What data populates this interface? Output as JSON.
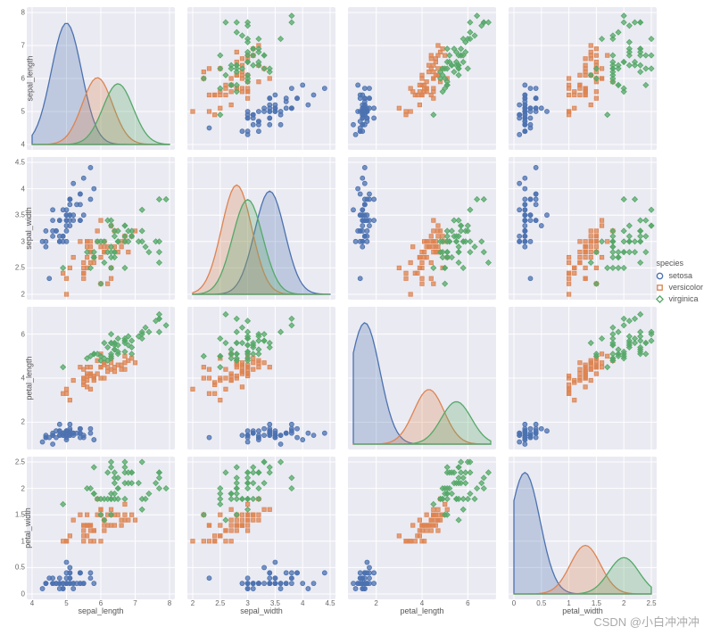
{
  "chart_data": {
    "type": "pairplot",
    "hue": "species",
    "variables": [
      "sepal_length",
      "sepal_width",
      "petal_length",
      "petal_width"
    ],
    "colors": {
      "setosa": "#4c72b0",
      "versicolor": "#dd8452",
      "virginica": "#55a868"
    },
    "markers": {
      "setosa": "circle",
      "versicolor": "square",
      "virginica": "diamond"
    },
    "ranges": {
      "sepal_length": [
        4,
        8
      ],
      "sepal_width": [
        2,
        4.5
      ],
      "petal_length": [
        1,
        7
      ],
      "petal_width": [
        0,
        2.5
      ]
    },
    "ticks": {
      "sepal_length": [
        4,
        5,
        6,
        7,
        8
      ],
      "sepal_width": [
        2.0,
        2.5,
        3.0,
        3.5,
        4.0,
        4.5
      ],
      "petal_length": [
        2,
        4,
        6
      ],
      "petal_width": [
        0.0,
        0.5,
        1.0,
        1.5,
        2.0,
        2.5
      ]
    },
    "kde_peaks": {
      "sepal_length": {
        "setosa": 5.0,
        "versicolor": 5.9,
        "virginica": 6.5
      },
      "sepal_width": {
        "setosa": 3.4,
        "versicolor": 2.8,
        "virginica": 3.0
      },
      "petal_length": {
        "setosa": 1.5,
        "versicolor": 4.3,
        "virginica": 5.5
      },
      "petal_width": {
        "setosa": 0.2,
        "versicolor": 1.3,
        "virginica": 2.0
      }
    },
    "legend": {
      "title": "species",
      "items": [
        "setosa",
        "versicolor",
        "virginica"
      ]
    },
    "data": {
      "setosa": {
        "sepal_length": [
          5.1,
          4.9,
          4.7,
          4.6,
          5.0,
          5.4,
          4.6,
          5.0,
          4.4,
          4.9,
          5.4,
          4.8,
          4.8,
          4.3,
          5.8,
          5.7,
          5.4,
          5.1,
          5.7,
          5.1,
          5.4,
          5.1,
          4.6,
          5.1,
          4.8,
          5.0,
          5.0,
          5.2,
          5.2,
          4.7,
          4.8,
          5.4,
          5.2,
          5.5,
          4.9,
          5.0,
          5.5,
          4.9,
          4.4,
          5.1,
          5.0,
          4.5,
          4.4,
          5.0,
          5.1,
          4.8,
          5.1,
          4.6,
          5.3,
          5.0
        ],
        "sepal_width": [
          3.5,
          3.0,
          3.2,
          3.1,
          3.6,
          3.9,
          3.4,
          3.4,
          2.9,
          3.1,
          3.7,
          3.4,
          3.0,
          3.0,
          4.0,
          4.4,
          3.9,
          3.5,
          3.8,
          3.8,
          3.4,
          3.7,
          3.6,
          3.3,
          3.4,
          3.0,
          3.4,
          3.5,
          3.4,
          3.2,
          3.1,
          3.4,
          4.1,
          4.2,
          3.1,
          3.2,
          3.5,
          3.6,
          3.0,
          3.4,
          3.5,
          2.3,
          3.2,
          3.5,
          3.8,
          3.0,
          3.8,
          3.2,
          3.7,
          3.3
        ],
        "petal_length": [
          1.4,
          1.4,
          1.3,
          1.5,
          1.4,
          1.7,
          1.4,
          1.5,
          1.4,
          1.5,
          1.5,
          1.6,
          1.4,
          1.1,
          1.2,
          1.5,
          1.3,
          1.4,
          1.7,
          1.5,
          1.7,
          1.5,
          1.0,
          1.7,
          1.9,
          1.6,
          1.6,
          1.5,
          1.4,
          1.6,
          1.6,
          1.5,
          1.5,
          1.4,
          1.5,
          1.2,
          1.3,
          1.4,
          1.3,
          1.5,
          1.3,
          1.3,
          1.3,
          1.6,
          1.9,
          1.4,
          1.6,
          1.4,
          1.5,
          1.4
        ],
        "petal_width": [
          0.2,
          0.2,
          0.2,
          0.2,
          0.2,
          0.4,
          0.3,
          0.2,
          0.2,
          0.1,
          0.2,
          0.2,
          0.1,
          0.1,
          0.2,
          0.4,
          0.4,
          0.3,
          0.3,
          0.3,
          0.2,
          0.4,
          0.2,
          0.5,
          0.2,
          0.2,
          0.4,
          0.2,
          0.2,
          0.2,
          0.2,
          0.4,
          0.1,
          0.2,
          0.2,
          0.2,
          0.2,
          0.1,
          0.2,
          0.2,
          0.3,
          0.3,
          0.2,
          0.6,
          0.4,
          0.3,
          0.2,
          0.2,
          0.2,
          0.2
        ]
      },
      "versicolor": {
        "sepal_length": [
          7.0,
          6.4,
          6.9,
          5.5,
          6.5,
          5.7,
          6.3,
          4.9,
          6.6,
          5.2,
          5.0,
          5.9,
          6.0,
          6.1,
          5.6,
          6.7,
          5.6,
          5.8,
          6.2,
          5.6,
          5.9,
          6.1,
          6.3,
          6.1,
          6.4,
          6.6,
          6.8,
          6.7,
          6.0,
          5.7,
          5.5,
          5.5,
          5.8,
          6.0,
          5.4,
          6.0,
          6.7,
          6.3,
          5.6,
          5.5,
          5.5,
          6.1,
          5.8,
          5.0,
          5.6,
          5.7,
          5.7,
          6.2,
          5.1,
          5.7
        ],
        "sepal_width": [
          3.2,
          3.2,
          3.1,
          2.3,
          2.8,
          2.8,
          3.3,
          2.4,
          2.9,
          2.7,
          2.0,
          3.0,
          2.2,
          2.9,
          2.9,
          3.1,
          3.0,
          2.7,
          2.2,
          2.5,
          3.2,
          2.8,
          2.5,
          2.8,
          2.9,
          3.0,
          2.8,
          3.0,
          2.9,
          2.6,
          2.4,
          2.4,
          2.7,
          2.7,
          3.0,
          3.4,
          3.1,
          2.3,
          3.0,
          2.5,
          2.6,
          3.0,
          2.6,
          2.3,
          2.7,
          3.0,
          2.9,
          2.9,
          2.5,
          2.8
        ],
        "petal_length": [
          4.7,
          4.5,
          4.9,
          4.0,
          4.6,
          4.5,
          4.7,
          3.3,
          4.6,
          3.9,
          3.5,
          4.2,
          4.0,
          4.7,
          3.6,
          4.4,
          4.5,
          4.1,
          4.5,
          3.9,
          4.8,
          4.0,
          4.9,
          4.7,
          4.3,
          4.4,
          4.8,
          5.0,
          4.5,
          3.5,
          3.8,
          3.7,
          3.9,
          5.1,
          4.5,
          4.5,
          4.7,
          4.4,
          4.1,
          4.0,
          4.4,
          4.6,
          4.0,
          3.3,
          4.2,
          4.2,
          4.2,
          4.3,
          3.0,
          4.1
        ],
        "petal_width": [
          1.4,
          1.5,
          1.5,
          1.3,
          1.5,
          1.3,
          1.6,
          1.0,
          1.3,
          1.4,
          1.0,
          1.5,
          1.0,
          1.4,
          1.3,
          1.4,
          1.5,
          1.0,
          1.5,
          1.1,
          1.8,
          1.3,
          1.5,
          1.2,
          1.3,
          1.4,
          1.4,
          1.7,
          1.5,
          1.0,
          1.1,
          1.0,
          1.2,
          1.6,
          1.5,
          1.6,
          1.5,
          1.3,
          1.3,
          1.3,
          1.2,
          1.4,
          1.2,
          1.0,
          1.3,
          1.2,
          1.3,
          1.3,
          1.1,
          1.3
        ]
      },
      "virginica": {
        "sepal_length": [
          6.3,
          5.8,
          7.1,
          6.3,
          6.5,
          7.6,
          4.9,
          7.3,
          6.7,
          7.2,
          6.5,
          6.4,
          6.8,
          5.7,
          5.8,
          6.4,
          6.5,
          7.7,
          7.7,
          6.0,
          6.9,
          5.6,
          7.7,
          6.3,
          6.7,
          7.2,
          6.2,
          6.1,
          6.4,
          7.2,
          7.4,
          7.9,
          6.4,
          6.3,
          6.1,
          7.7,
          6.3,
          6.4,
          6.0,
          6.9,
          6.7,
          6.9,
          5.8,
          6.8,
          6.7,
          6.7,
          6.3,
          6.5,
          6.2,
          5.9
        ],
        "sepal_width": [
          3.3,
          2.7,
          3.0,
          2.9,
          3.0,
          3.0,
          2.5,
          2.9,
          2.5,
          3.6,
          3.2,
          2.7,
          3.0,
          2.5,
          2.8,
          3.2,
          3.0,
          3.8,
          2.6,
          2.2,
          3.2,
          2.8,
          2.8,
          2.7,
          3.3,
          3.2,
          2.8,
          3.0,
          2.8,
          3.0,
          2.8,
          3.8,
          2.8,
          2.8,
          2.6,
          3.0,
          3.4,
          3.1,
          3.0,
          3.1,
          3.1,
          3.1,
          2.7,
          3.2,
          3.3,
          3.0,
          2.5,
          3.0,
          3.4,
          3.0
        ],
        "petal_length": [
          6.0,
          5.1,
          5.9,
          5.6,
          5.8,
          6.6,
          4.5,
          6.3,
          5.8,
          6.1,
          5.1,
          5.3,
          5.5,
          5.0,
          5.1,
          5.3,
          5.5,
          6.7,
          6.9,
          5.0,
          5.7,
          4.9,
          6.7,
          4.9,
          5.7,
          6.0,
          4.8,
          4.9,
          5.6,
          5.8,
          6.1,
          6.4,
          5.6,
          5.1,
          5.6,
          6.1,
          5.6,
          5.5,
          4.8,
          5.4,
          5.6,
          5.1,
          5.1,
          5.9,
          5.7,
          5.2,
          5.0,
          5.2,
          5.4,
          5.1
        ],
        "petal_width": [
          2.5,
          1.9,
          2.1,
          1.8,
          2.2,
          2.1,
          1.7,
          1.8,
          1.8,
          2.5,
          2.0,
          1.9,
          2.1,
          2.0,
          2.4,
          2.3,
          1.8,
          2.2,
          2.3,
          1.5,
          2.3,
          2.0,
          2.0,
          1.8,
          2.1,
          1.8,
          1.8,
          1.8,
          2.1,
          1.6,
          1.9,
          2.0,
          2.2,
          1.5,
          1.4,
          2.3,
          2.4,
          1.8,
          1.8,
          2.1,
          2.4,
          2.3,
          1.9,
          2.3,
          2.5,
          2.3,
          1.9,
          2.0,
          2.3,
          1.8
        ]
      }
    }
  },
  "watermark": "CSDN @小白冲冲冲"
}
